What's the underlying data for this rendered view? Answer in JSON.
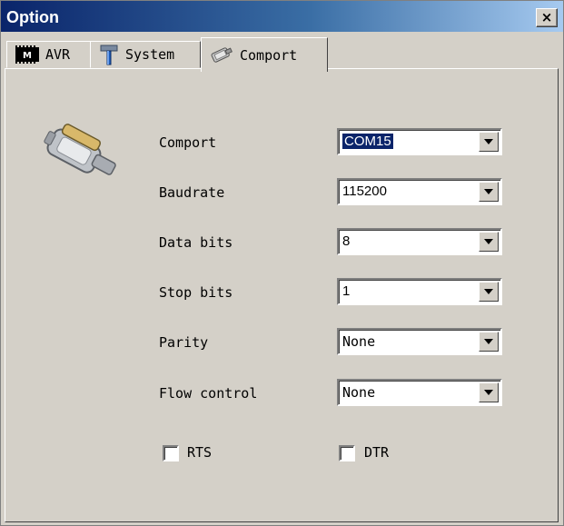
{
  "window": {
    "title": "Option",
    "close_label": "×"
  },
  "tabs": [
    {
      "label": "AVR",
      "icon": "chip-icon"
    },
    {
      "label": "System",
      "icon": "hammer-icon"
    },
    {
      "label": "Comport",
      "icon": "serial-port-icon",
      "active": true
    }
  ],
  "fields": [
    {
      "label": "Comport",
      "value": "COM15"
    },
    {
      "label": "Baudrate",
      "value": "115200"
    },
    {
      "label": "Data bits",
      "value": "8"
    },
    {
      "label": "Stop bits",
      "value": "1"
    },
    {
      "label": "Parity",
      "value": "None"
    },
    {
      "label": "Flow control",
      "value": "None"
    }
  ],
  "checkboxes": [
    {
      "label": "RTS",
      "checked": false
    },
    {
      "label": "DTR",
      "checked": false
    }
  ],
  "colors": {
    "title_start": "#0a246a",
    "title_end": "#a6caf0",
    "face": "#d4d0c8",
    "selection": "#0a246a"
  }
}
